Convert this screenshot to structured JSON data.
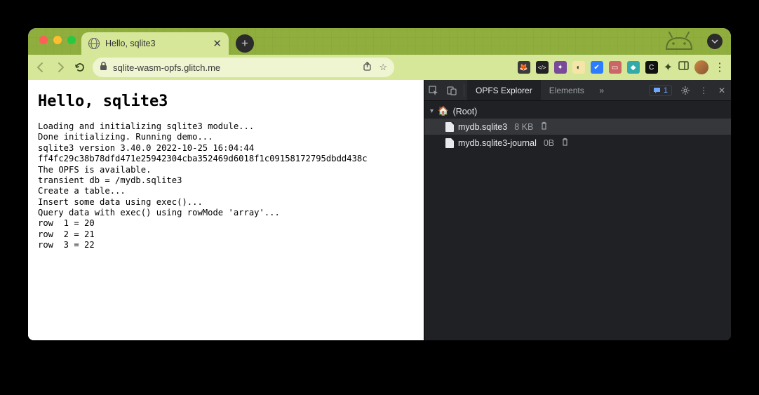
{
  "tab": {
    "title": "Hello, sqlite3"
  },
  "url": "sqlite-wasm-opfs.glitch.me",
  "page": {
    "heading": "Hello, sqlite3",
    "log": "Loading and initializing sqlite3 module...\nDone initializing. Running demo...\nsqlite3 version 3.40.0 2022-10-25 16:04:44\nff4fc29c38b78dfd471e25942304cba352469d6018f1c09158172795dbdd438c\nThe OPFS is available.\ntransient db = /mydb.sqlite3\nCreate a table...\nInsert some data using exec()...\nQuery data with exec() using rowMode 'array'...\nrow  1 = 20\nrow  2 = 21\nrow  3 = 22"
  },
  "devtools": {
    "tabs": {
      "active": "OPFS Explorer",
      "other": "Elements"
    },
    "badge_count": "1",
    "tree": {
      "root_label": "(Root)",
      "files": [
        {
          "name": "mydb.sqlite3",
          "size": "8 KB"
        },
        {
          "name": "mydb.sqlite3-journal",
          "size": "0B"
        }
      ]
    }
  },
  "extensions": [
    {
      "name": "ext-1",
      "bg": "#3a3a3a",
      "glyph": "🦊"
    },
    {
      "name": "ext-2",
      "bg": "#222",
      "glyph": "</>"
    },
    {
      "name": "ext-3",
      "bg": "#7a4",
      "glyph": "✦"
    },
    {
      "name": "ext-4",
      "bg": "#ffb",
      "glyph": "◐"
    },
    {
      "name": "ext-5",
      "bg": "#2d7cff",
      "glyph": "✔"
    },
    {
      "name": "ext-6",
      "bg": "#c66",
      "glyph": "🛏"
    },
    {
      "name": "ext-7",
      "bg": "#2aa",
      "glyph": "◆"
    },
    {
      "name": "ext-8",
      "bg": "#111",
      "glyph": "C"
    }
  ]
}
